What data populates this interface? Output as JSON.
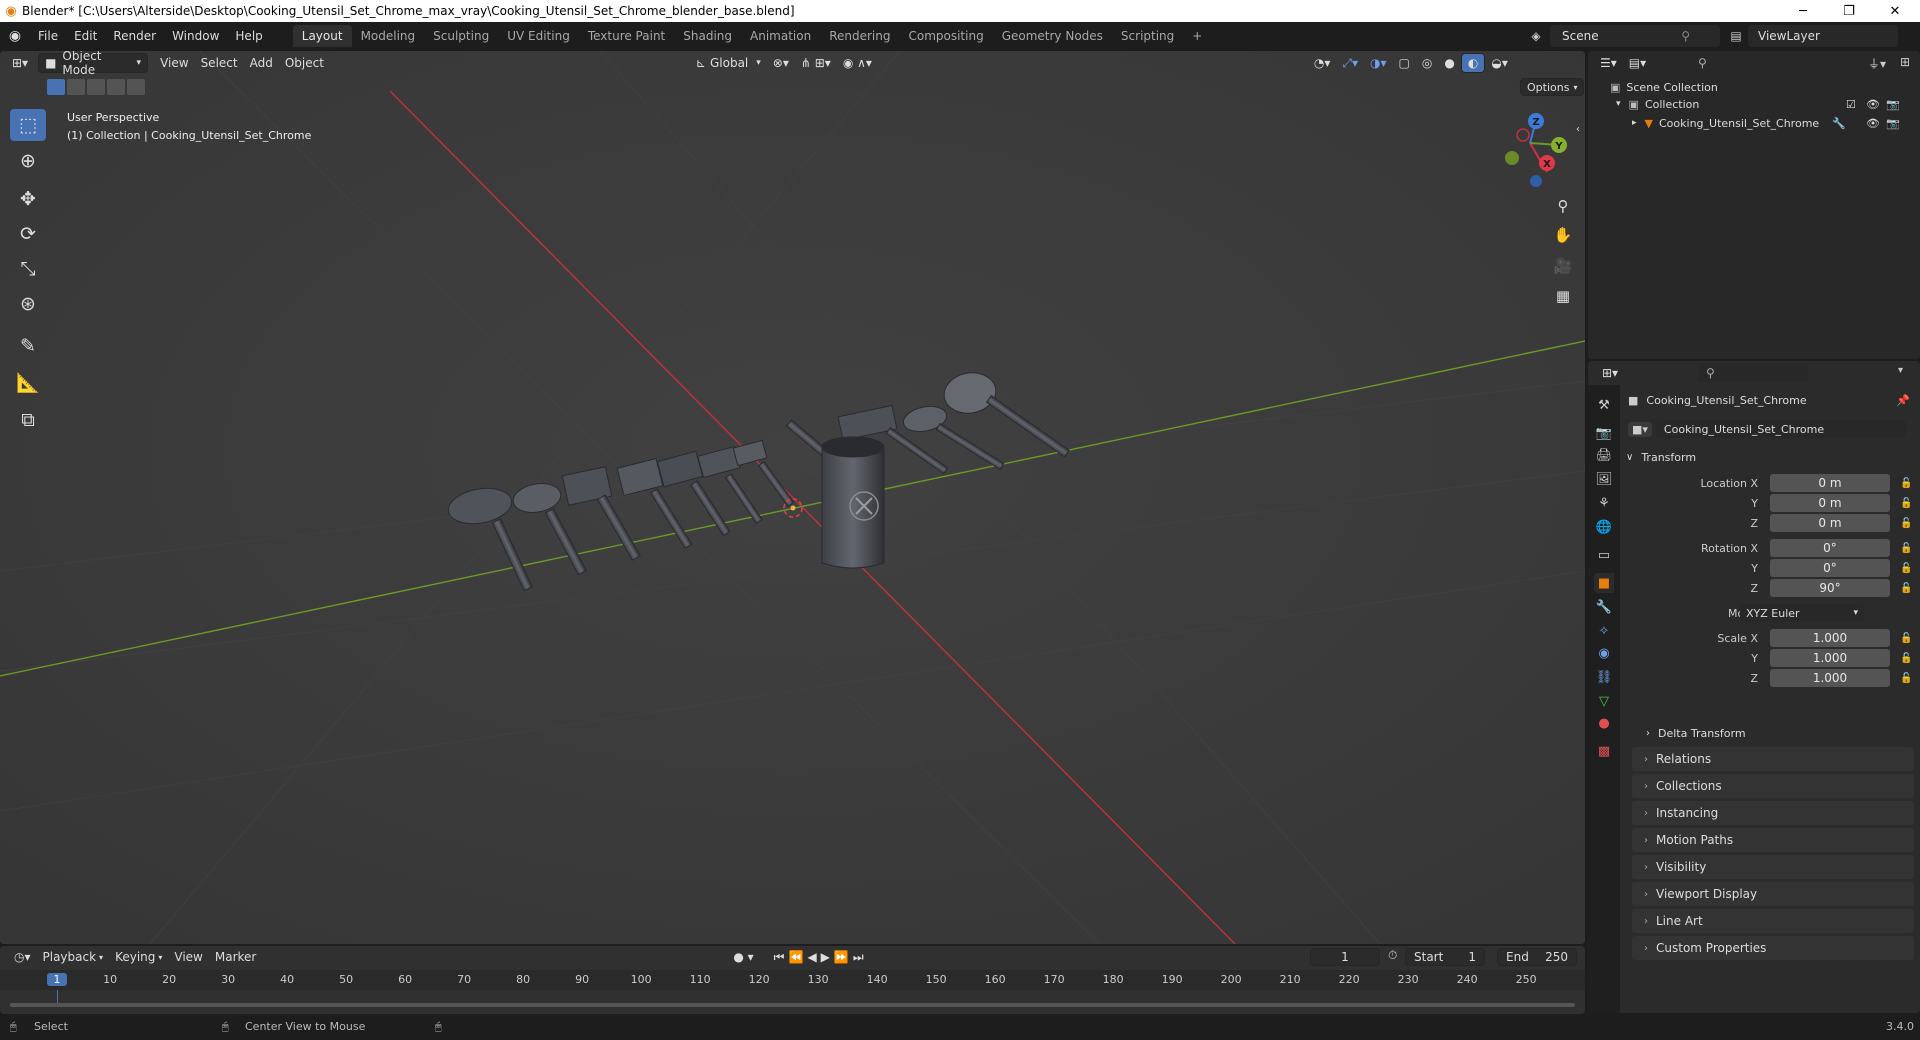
{
  "window": {
    "title": "Blender* [C:\\Users\\Alterside\\Desktop\\Cooking_Utensil_Set_Chrome_max_vray\\Cooking_Utensil_Set_Chrome_blender_base.blend]",
    "minimize": "─",
    "restore": "❐",
    "close": "✕"
  },
  "menus": [
    "File",
    "Edit",
    "Render",
    "Window",
    "Help"
  ],
  "workspaces": [
    "Layout",
    "Modeling",
    "Sculpting",
    "UV Editing",
    "Texture Paint",
    "Shading",
    "Animation",
    "Rendering",
    "Compositing",
    "Geometry Nodes",
    "Scripting"
  ],
  "workspace_add": "+",
  "scene": {
    "name": "Scene",
    "view_layer": "ViewLayer"
  },
  "viewport": {
    "mode": "Object Mode",
    "menus": [
      "View",
      "Select",
      "Add",
      "Object"
    ],
    "orientation": "Global",
    "options": "Options",
    "overlay_title": "User Perspective",
    "overlay_subtitle": "(1) Collection | Cooking_Utensil_Set_Chrome",
    "gizmo": {
      "x": "X",
      "y": "Y",
      "z": "Z"
    }
  },
  "outliner": {
    "scene_collection": "Scene Collection",
    "collection": "Collection",
    "object": "Cooking_Utensil_Set_Chrome"
  },
  "properties": {
    "object_name": "Cooking_Utensil_Set_Chrome",
    "datablock": "Cooking_Utensil_Set_Chrome",
    "transform_label": "Transform",
    "location_label": "Location X",
    "rotation_label": "Rotation X",
    "scale_label": "Scale X",
    "y_label": "Y",
    "z_label": "Z",
    "mode_label": "Mode",
    "mode_value": "XYZ Euler",
    "location": [
      "0 m",
      "0 m",
      "0 m"
    ],
    "rotation": [
      "0°",
      "0°",
      "90°"
    ],
    "scale": [
      "1.000",
      "1.000",
      "1.000"
    ],
    "delta": "Delta Transform",
    "panels": [
      "Relations",
      "Collections",
      "Instancing",
      "Motion Paths",
      "Visibility",
      "Viewport Display",
      "Line Art",
      "Custom Properties"
    ]
  },
  "timeline": {
    "menus": [
      "Playback",
      "Keying",
      "View",
      "Marker"
    ],
    "current_frame": "1",
    "start_label": "Start",
    "start": "1",
    "end_label": "End",
    "end": "250",
    "ruler": [
      "1",
      "10",
      "20",
      "30",
      "40",
      "50",
      "60",
      "70",
      "80",
      "90",
      "100",
      "110",
      "120",
      "130",
      "140",
      "150",
      "160",
      "170",
      "180",
      "190",
      "200",
      "210",
      "220",
      "230",
      "240",
      "250"
    ]
  },
  "status": {
    "left": "Select",
    "middle": "Center View to Mouse",
    "version": "3.4.0"
  },
  "colors": {
    "accent": "#4772b3",
    "x_axis": "#d03040",
    "y_axis": "#6a9a28",
    "z_axis": "#3b7dd8",
    "object_orange": "#e87d0d"
  }
}
